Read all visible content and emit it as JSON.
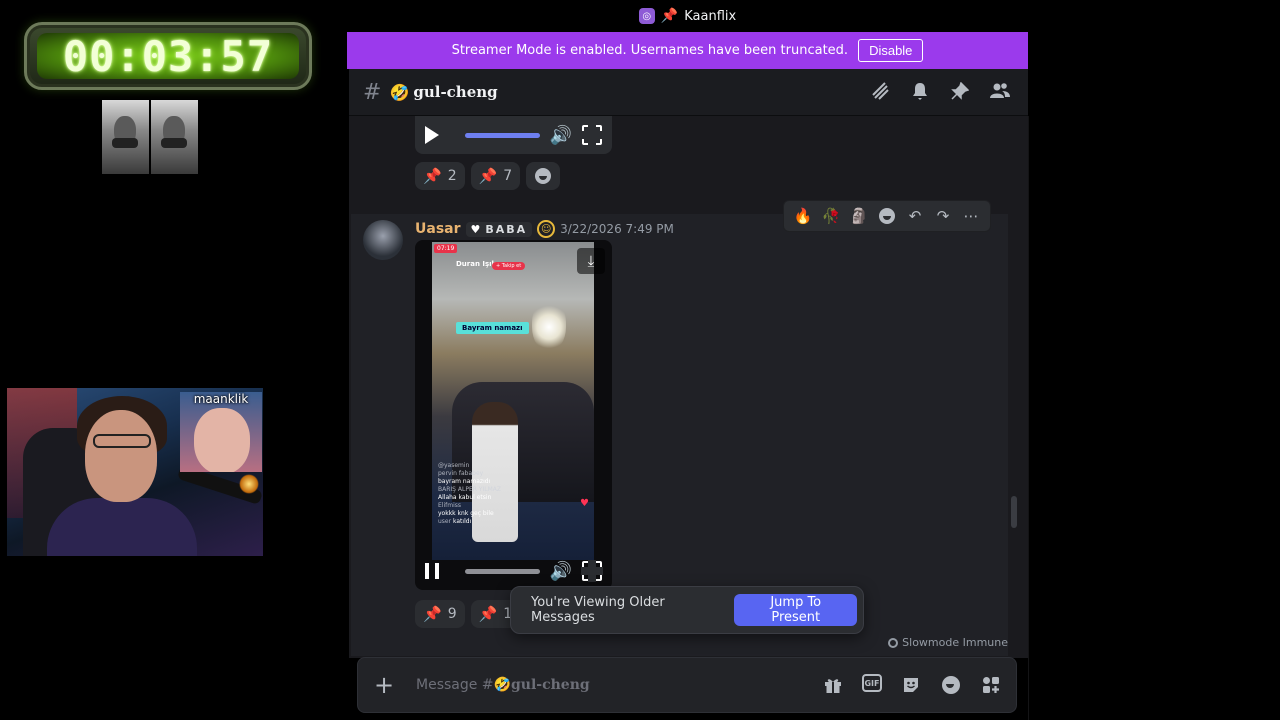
{
  "stream": {
    "timer": "00:03:57",
    "webcam_overlay_label": "maanklik"
  },
  "window": {
    "title": "Kaanflix"
  },
  "streamer_mode": {
    "text": "Streamer Mode is enabled. Usernames have been truncated.",
    "button": "Disable"
  },
  "channel": {
    "hash": "#",
    "emoji": "🤣",
    "name": "gul-cheng",
    "header_icons": [
      "threads-icon",
      "bell-icon",
      "pin-icon",
      "members-icon"
    ]
  },
  "previous_message": {
    "reactions": [
      {
        "icon": "blue-pin",
        "count": "2"
      },
      {
        "icon": "pink-pin",
        "count": "7"
      }
    ]
  },
  "hover_toolbar": {
    "emojis": [
      "🔥",
      "🥀",
      "🗿"
    ]
  },
  "message": {
    "username": "Uasar",
    "clan_tag": "BABA",
    "timestamp": "3/22/2026 7:49 PM",
    "tiktok": {
      "live_time": "07:19",
      "streamer": "Duran Işık",
      "follow": "+ Takip et",
      "caption": "Bayram namazı",
      "chat": [
        {
          "user": "@yasemin",
          "text": ""
        },
        {
          "user": "pervin fababey",
          "text": "bayram namazıdı"
        },
        {
          "user": "BARIŞ ALPER YILMAZ",
          "text": "Allaha kabul etsin"
        },
        {
          "user": "Elifmiss",
          "text": "yokkk knk geç bile"
        },
        {
          "user": "user",
          "text": "katıldı"
        }
      ]
    },
    "reactions": [
      {
        "icon": "blue-pin",
        "count": "9"
      },
      {
        "icon": "pink-pin",
        "count": "1"
      }
    ]
  },
  "jump": {
    "text": "You're Viewing Older Messages",
    "button": "Jump To Present"
  },
  "slowmode": "Slowmode Immune",
  "composer": {
    "placeholder_prefix": "Message #",
    "placeholder_emoji": "🤣",
    "placeholder_channel": "gul-cheng",
    "gif_label": "GIF"
  },
  "colors": {
    "streamer_banner": "#9b3aec",
    "accent": "#5865f2",
    "username": "#e8b370"
  }
}
